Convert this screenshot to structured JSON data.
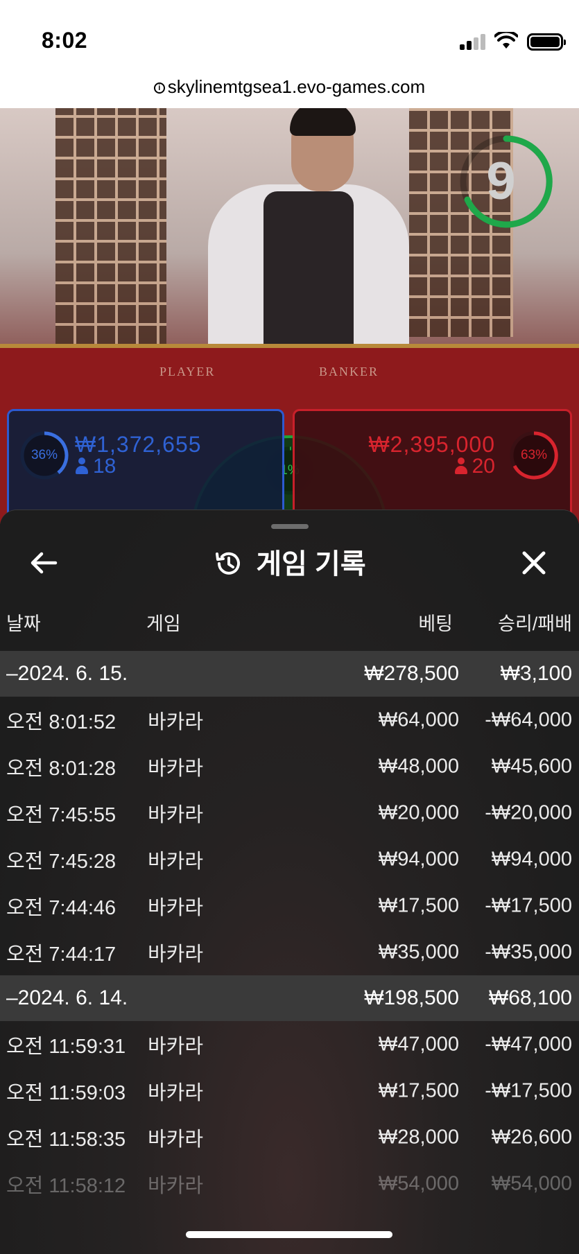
{
  "status_bar": {
    "time": "8:02"
  },
  "browser": {
    "url": "skylinemtgsea1.evo-games.com"
  },
  "video": {
    "countdown": "9",
    "felt_player": "PLAYER",
    "felt_banker": "BANKER",
    "player": {
      "percent": "36%",
      "amount": "₩1,372,655",
      "count": "18",
      "color": "#3a6fe0"
    },
    "banker": {
      "percent": "63%",
      "amount": "₩2,395,000",
      "count": "20",
      "color": "#d8242e"
    },
    "tie": {
      "percent": "1%",
      "color": "#1ea43b"
    }
  },
  "sheet": {
    "title": "게임 기록",
    "icons": {
      "back": "arrow-left-icon",
      "history": "history-icon",
      "close": "close-icon"
    },
    "columns": {
      "date": "날짜",
      "game": "게임",
      "bet": "베팅",
      "win_loss": "승리/패배"
    },
    "days": [
      {
        "date": "–2024. 6. 15.",
        "bet": "₩278,500",
        "win_loss": "₩3,100",
        "rows": [
          {
            "time": "오전 8:01:52",
            "game": "바카라",
            "bet": "₩64,000",
            "win_loss": "-₩64,000"
          },
          {
            "time": "오전 8:01:28",
            "game": "바카라",
            "bet": "₩48,000",
            "win_loss": "₩45,600"
          },
          {
            "time": "오전 7:45:55",
            "game": "바카라",
            "bet": "₩20,000",
            "win_loss": "-₩20,000"
          },
          {
            "time": "오전 7:45:28",
            "game": "바카라",
            "bet": "₩94,000",
            "win_loss": "₩94,000"
          },
          {
            "time": "오전 7:44:46",
            "game": "바카라",
            "bet": "₩17,500",
            "win_loss": "-₩17,500"
          },
          {
            "time": "오전 7:44:17",
            "game": "바카라",
            "bet": "₩35,000",
            "win_loss": "-₩35,000"
          }
        ]
      },
      {
        "date": "–2024. 6. 14.",
        "bet": "₩198,500",
        "win_loss": "₩68,100",
        "rows": [
          {
            "time": "오전 11:59:31",
            "game": "바카라",
            "bet": "₩47,000",
            "win_loss": "-₩47,000"
          },
          {
            "time": "오전 11:59:03",
            "game": "바카라",
            "bet": "₩17,500",
            "win_loss": "-₩17,500"
          },
          {
            "time": "오전 11:58:35",
            "game": "바카라",
            "bet": "₩28,000",
            "win_loss": "₩26,600"
          },
          {
            "time": "오전 11:58:12",
            "game": "바카라",
            "bet": "₩54,000",
            "win_loss": "₩54,000"
          }
        ]
      }
    ]
  }
}
